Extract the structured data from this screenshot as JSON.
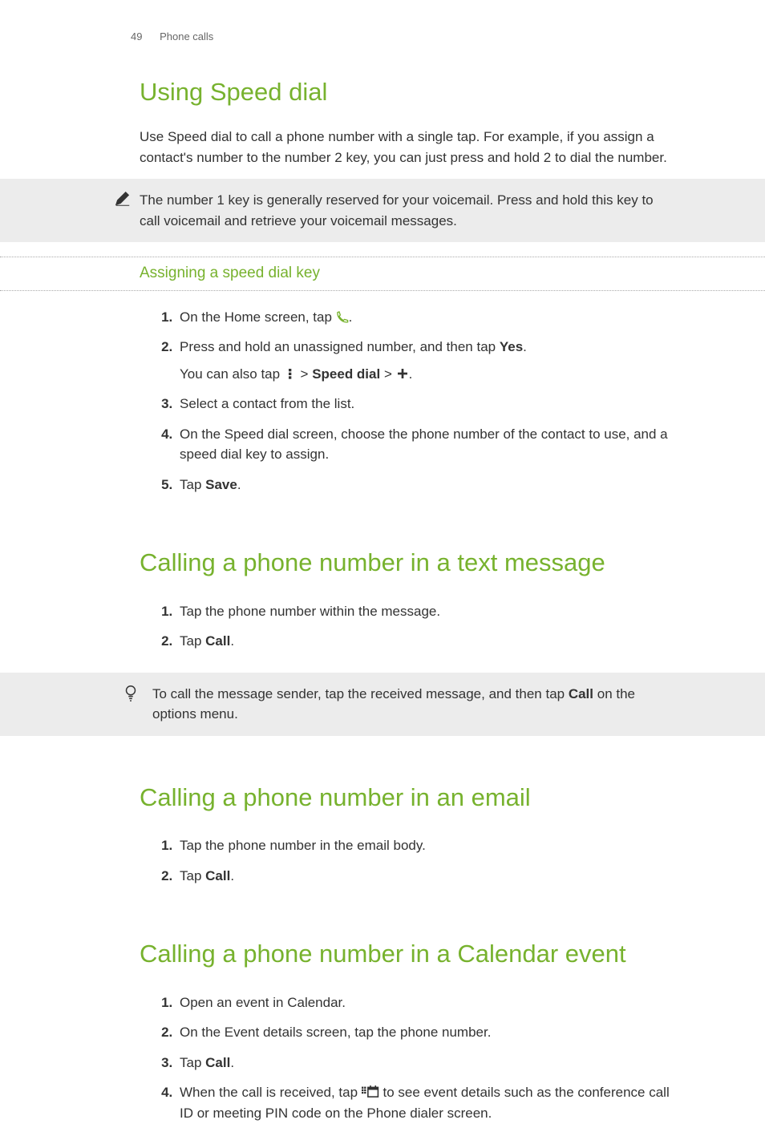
{
  "header": {
    "page_number": "49",
    "chapter": "Phone calls"
  },
  "s1": {
    "title": "Using Speed dial",
    "intro": "Use Speed dial to call a phone number with a single tap. For example, if you assign a contact's number to the number 2 key, you can just press and hold 2 to dial the number.",
    "note": "The number 1 key is generally reserved for your voicemail. Press and hold this key to call voicemail and retrieve your voicemail messages.",
    "sub_title": "Assigning a speed dial key",
    "steps": {
      "i1_a": "On the Home screen, tap ",
      "i1_b": ".",
      "i2_a": "Press and hold an unassigned number, and then tap ",
      "i2_yes": "Yes",
      "i2_b": ".",
      "i2_sub_a": "You can also tap ",
      "i2_sub_sep1": " > ",
      "i2_sub_sd": "Speed dial",
      "i2_sub_sep2": " > ",
      "i2_sub_b": ".",
      "i3": "Select a contact from the list.",
      "i4": "On the Speed dial screen, choose the phone number of the contact to use, and a speed dial key to assign.",
      "i5_a": "Tap ",
      "i5_save": "Save",
      "i5_b": "."
    }
  },
  "s2": {
    "title": "Calling a phone number in a text message",
    "steps": {
      "i1": "Tap the phone number within the message.",
      "i2_a": "Tap ",
      "i2_call": "Call",
      "i2_b": "."
    },
    "tip_a": "To call the message sender, tap the received message, and then tap ",
    "tip_call": "Call",
    "tip_b": " on the options menu."
  },
  "s3": {
    "title": "Calling a phone number in an email",
    "steps": {
      "i1": "Tap the phone number in the email body.",
      "i2_a": "Tap ",
      "i2_call": "Call",
      "i2_b": "."
    }
  },
  "s4": {
    "title": "Calling a phone number in a Calendar event",
    "steps": {
      "i1": "Open an event in Calendar.",
      "i2": "On the Event details screen, tap the phone number.",
      "i3_a": "Tap ",
      "i3_call": "Call",
      "i3_b": ".",
      "i4_a": "When the call is received, tap ",
      "i4_b": " to see event details such as the conference call ID or meeting PIN code on the Phone dialer screen."
    }
  }
}
